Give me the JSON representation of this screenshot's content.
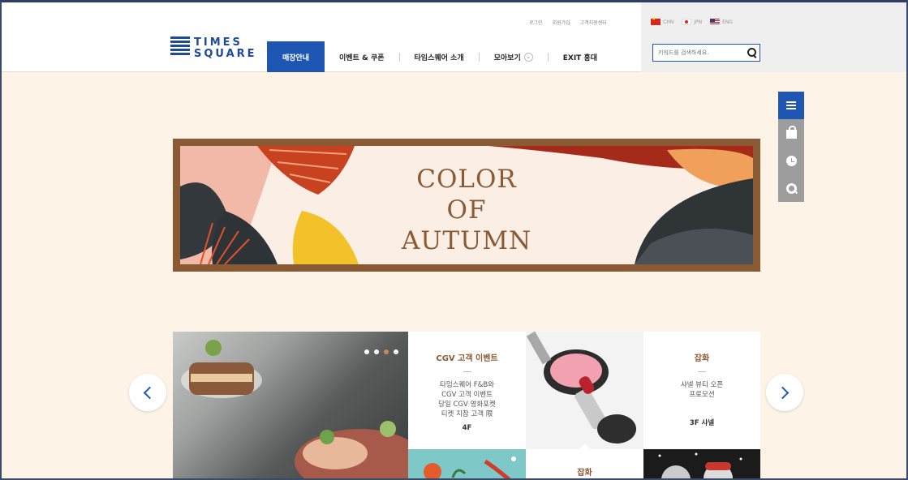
{
  "header": {
    "util_links": [
      "로그인",
      "회원가입",
      "고객지원센터"
    ],
    "languages": [
      {
        "code": "CHN",
        "flag": "china-flag-icon"
      },
      {
        "code": "JPN",
        "flag": "japan-flag-icon"
      },
      {
        "code": "ENG",
        "flag": "usa-flag-icon"
      }
    ],
    "logo": {
      "line1": "TIMES",
      "line2": "SQUARE",
      "color": "#1f4a96"
    },
    "nav": [
      {
        "label": "매장안내",
        "active": true
      },
      {
        "label": "이벤트 & 쿠폰",
        "active": false
      },
      {
        "label": "타임스퀘어 소개",
        "active": false
      },
      {
        "label": "모아보기",
        "active": false
      },
      {
        "label": "EXIT 홍대",
        "active": false
      }
    ],
    "search": {
      "placeholder": "키워드를 검색하세요."
    }
  },
  "quick_menu": [
    "menu-icon",
    "shopping-bag-icon",
    "clock-icon",
    "q-icon"
  ],
  "banner": {
    "title_lines": [
      "COLOR",
      "OF",
      "AUTUMN"
    ]
  },
  "promo": {
    "dots": 4,
    "active_dot": 2,
    "card_cgv": {
      "title": "CGV 고객 이벤트",
      "body_lines": [
        "타임스퀘어 F&B와",
        "CGV 고객 이벤트",
        "당일 CGV 영화포켓",
        "티켓 지참 고객 限"
      ],
      "floor": "4F"
    },
    "card_beauty": {
      "title": "잡화",
      "body_lines": [
        "샤넬 뷰티 오픈",
        "프로모션"
      ],
      "floor": "3F 샤넬"
    },
    "card_small": {
      "title": "잡화"
    }
  },
  "colors": {
    "brand_blue": "#1f56b4",
    "banner_frame": "#8a5a35",
    "page_bg": "#fdf3e7"
  }
}
